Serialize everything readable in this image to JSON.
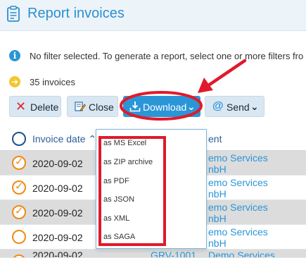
{
  "header": {
    "title": "Report invoices",
    "icon": "clipboard-icon"
  },
  "info": {
    "text": "No filter selected. To generate a report, select one or more filters fro",
    "icon": "info-icon"
  },
  "count": {
    "text": "35 invoices",
    "icon": "arrow-right-icon"
  },
  "toolbar": {
    "delete_label": "Delete",
    "close_label": "Close",
    "download_label": "Download",
    "send_label": "Send"
  },
  "table": {
    "headers": {
      "date": "Invoice date",
      "client": "ent"
    },
    "rows": [
      {
        "date": "2020-09-02",
        "client_line1": "emo Services",
        "client_line2": "nbH",
        "checked": true,
        "shaded": true
      },
      {
        "date": "2020-09-02",
        "client_line1": "emo Services",
        "client_line2": "nbH",
        "checked": true,
        "shaded": false
      },
      {
        "date": "2020-09-02",
        "client_line1": "emo Services",
        "client_line2": "nbH",
        "checked": true,
        "shaded": true
      },
      {
        "date": "2020-09-02",
        "client_line1": "emo Services",
        "client_line2": "nbH",
        "checked": false,
        "shaded": false
      },
      {
        "date": "2020-09-02",
        "number": "GRV-1001",
        "client_line1": "Demo Services",
        "checked": false,
        "shaded": true
      }
    ]
  },
  "download_menu": {
    "items": [
      "as MS Excel",
      "as ZIP archive",
      "as PDF",
      "as JSON",
      "as XML",
      "as SAGA"
    ]
  },
  "colors": {
    "accent": "#2a96d8",
    "annotation": "#e01a2b",
    "checkbox": "#ef8a16"
  }
}
